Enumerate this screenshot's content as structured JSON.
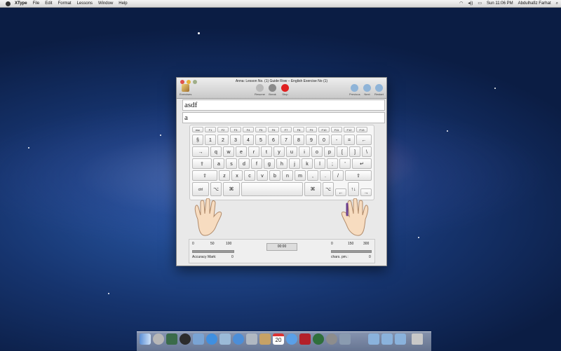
{
  "menubar": {
    "app_name": "XType",
    "items": [
      "File",
      "Edit",
      "Format",
      "Lessons",
      "Window",
      "Help"
    ],
    "clock": "Sun 11:06 PM",
    "user": "Abdulhafiz Farhat"
  },
  "window": {
    "title": "Anna: Lesson No. (1) Guide Row – English Exercise No (1)",
    "toolbar": {
      "left": {
        "label": "Exercises",
        "icon": "pencil-icon"
      },
      "center": [
        {
          "label": "Resume",
          "icon": "resume-icon",
          "color": "#b9b9b9"
        },
        {
          "label": "Break",
          "icon": "break-icon",
          "color": "#8a8a8a"
        },
        {
          "label": "Stop",
          "icon": "stop-icon",
          "color": "#e02020"
        }
      ],
      "right": [
        {
          "label": "Previous",
          "icon": "previous-icon"
        },
        {
          "label": "Next",
          "icon": "next-icon"
        },
        {
          "label": "Restart",
          "icon": "restart-icon"
        }
      ]
    },
    "exercise_text": "asdf",
    "typed_text": "a",
    "keyboard": {
      "row_f": [
        "esc",
        "F1",
        "F2",
        "F3",
        "F4",
        "F5",
        "F6",
        "F7",
        "F8",
        "F9",
        "F10",
        "F11",
        "F12",
        "F13"
      ],
      "row_num": [
        "§",
        "1",
        "2",
        "3",
        "4",
        "5",
        "6",
        "7",
        "8",
        "9",
        "0",
        "-",
        "=",
        "←"
      ],
      "row_q": [
        "→",
        "q",
        "w",
        "e",
        "r",
        "t",
        "y",
        "u",
        "i",
        "o",
        "p",
        "[",
        "]",
        "\\"
      ],
      "row_a": [
        "⇪",
        "a",
        "s",
        "d",
        "f",
        "g",
        "h",
        "j",
        "k",
        "l",
        ";",
        "'",
        "↵"
      ],
      "row_z": [
        "⇧",
        "z",
        "x",
        "c",
        "v",
        "b",
        "n",
        "m",
        ",",
        ".",
        "/",
        "⇧"
      ],
      "row_space": [
        "ctrl",
        "⌥",
        "⌘",
        "",
        "⌘",
        "⌥",
        "←",
        "↑↓",
        "→"
      ]
    },
    "stats": {
      "accuracy_scale": [
        "0",
        "50",
        "100"
      ],
      "accuracy_label": "Accuracy Mark:",
      "accuracy_value": "0",
      "timer": "00:00",
      "speed_scale": [
        "0",
        "150",
        "300"
      ],
      "speed_label": "chars. pm.:",
      "speed_value": "0"
    }
  },
  "dock": {
    "icons": [
      "finder-icon",
      "launchpad-icon",
      "mission-control-icon",
      "dashboard-icon",
      "preview-icon",
      "app-store-icon",
      "facetime-icon",
      "safari-icon",
      "mail-icon",
      "contacts-icon",
      "calendar-icon",
      "itunes-icon",
      "photo-booth-icon",
      "time-machine-icon",
      "system-preferences-icon",
      "xtype-icon",
      "applications-folder-icon",
      "documents-folder-icon",
      "downloads-folder-icon",
      "trash-icon"
    ],
    "calendar_day": "20"
  },
  "colors": {
    "stop": "#e02020",
    "finger_highlight": "#6b3f8f"
  }
}
